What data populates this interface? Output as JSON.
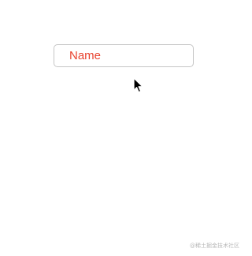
{
  "form": {
    "name_field": {
      "placeholder": "Name",
      "value": ""
    }
  },
  "cursor": {
    "icon": "arrow-pointer-icon"
  },
  "watermark": {
    "text": "@稀土掘金技术社区"
  },
  "colors": {
    "placeholder": "#e8432f",
    "border": "#c6c6c6"
  }
}
